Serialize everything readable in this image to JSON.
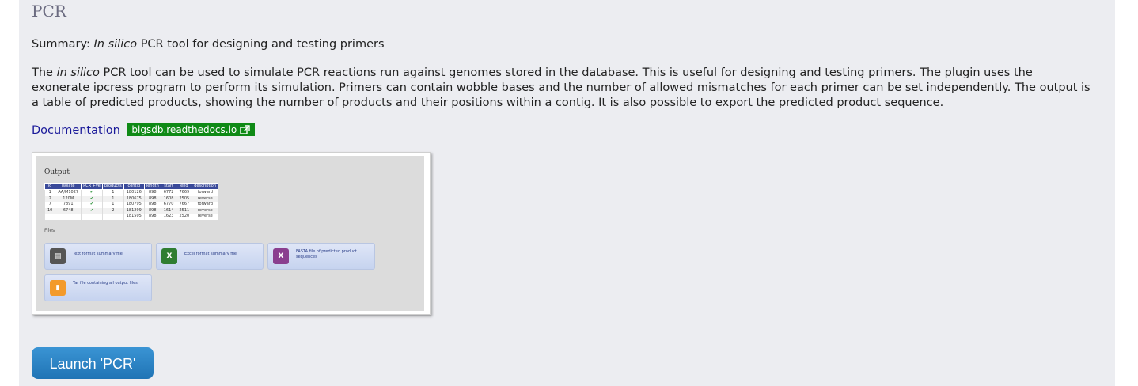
{
  "plugin": {
    "title": "PCR",
    "summary_label": "Summary:",
    "summary_italic": "In silico",
    "summary_rest": "PCR tool for designing and testing primers",
    "desc_prefix": "The",
    "desc_italic": "in silico",
    "description": "PCR tool can be used to simulate PCR reactions run against genomes stored in the database. This is useful for designing and testing primers. The plugin uses the exonerate ipcress program to perform its simulation. Primers can contain wobble bases and the number of allowed mismatches for each primer can be set independently. The output is a table of predicted products, showing the number of products and their positions within a contig. It is also possible to export the predicted product sequence.",
    "documentation_label": "Documentation",
    "documentation_badge": "bigsdb.readthedocs.io",
    "launch_label": "Launch 'PCR'"
  },
  "screenshot": {
    "output_heading": "Output",
    "headers": [
      "id",
      "isolate",
      "PCR +ve",
      "products",
      "contig",
      "length",
      "start",
      "end",
      "description"
    ],
    "rows": [
      [
        "1",
        "AA/M1027",
        "✔",
        "1",
        "180126",
        "898",
        "6772",
        "7669",
        "forward"
      ],
      [
        "2",
        "120M",
        "✔",
        "1",
        "180675",
        "898",
        "1608",
        "2505",
        "reverse"
      ],
      [
        "7",
        "7891",
        "✔",
        "1",
        "180795",
        "898",
        "6770",
        "7667",
        "forward"
      ],
      [
        "10",
        "6748",
        "✔",
        "2",
        "181299",
        "898",
        "1614",
        "2511",
        "reverse"
      ],
      [
        "",
        "",
        "",
        "",
        "181505",
        "898",
        "1623",
        "2520",
        "reverse"
      ]
    ],
    "files_heading": "Files",
    "files": [
      {
        "label": "Text format summary file",
        "icon": "text-file-icon",
        "color": "#555555",
        "glyph": "▤"
      },
      {
        "label": "Excel format summary file",
        "icon": "excel-file-icon",
        "color": "#2f7d32",
        "glyph": "X"
      },
      {
        "label": "FASTA file of predicted product sequences",
        "icon": "fasta-file-icon",
        "color": "#8a3f8f",
        "glyph": "X"
      },
      {
        "label": "Tar file containing all output files",
        "icon": "archive-file-icon",
        "color": "#f39a2b",
        "glyph": "▮"
      }
    ]
  }
}
